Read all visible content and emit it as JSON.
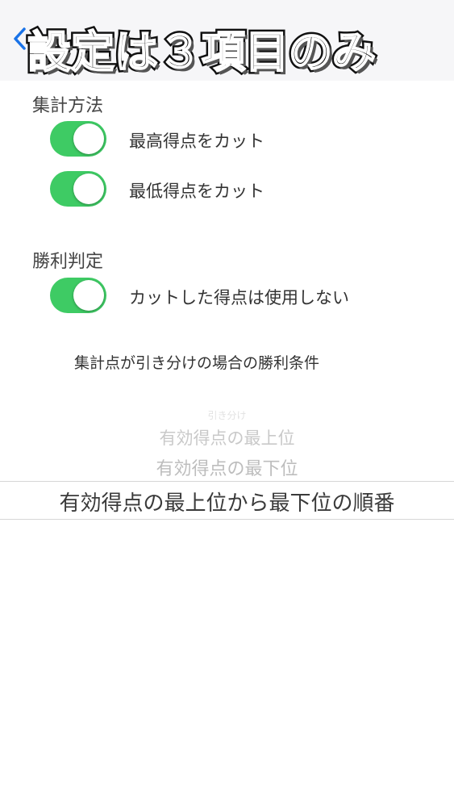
{
  "nav": {
    "back_icon": "chevron-left-icon",
    "overlay_title": "設定は３項目のみ"
  },
  "colors": {
    "toggle_on": "#3ecb64",
    "back_accent": "#1a73e8"
  },
  "sections": {
    "aggregation": {
      "header": "集計方法",
      "items": [
        {
          "label": "最高得点をカット",
          "on": true
        },
        {
          "label": "最低得点をカット",
          "on": true
        }
      ]
    },
    "victory": {
      "header": "勝利判定",
      "items": [
        {
          "label": "カットした得点は使用しない",
          "on": true
        }
      ],
      "note": "集計点が引き分けの場合の勝利条件"
    }
  },
  "picker": {
    "options": [
      "引き分け",
      "有効得点の最上位",
      "有効得点の最下位",
      "有効得点の最上位から最下位の順番"
    ],
    "selected": "有効得点の最上位から最下位の順番"
  }
}
